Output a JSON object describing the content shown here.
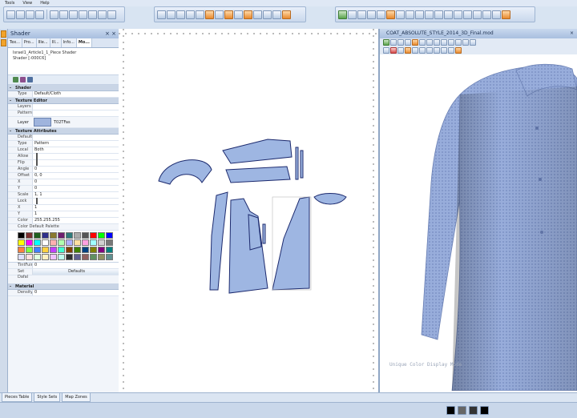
{
  "menu": [
    "Tools",
    "View",
    "Help"
  ],
  "shader_panel": {
    "title": "Shader",
    "close": "× ×",
    "tabs": [
      "Tex...",
      "Pro...",
      "Ille...",
      "Ill...",
      "Info...",
      "Mo..."
    ],
    "info_lines": [
      "Israel1_Article1_1_Piece Shader",
      "Shader [-000C6]"
    ],
    "sections": {
      "shader": "Shader",
      "type_label": "Type",
      "type_value": "Default/Cloth",
      "texture_editor": "Texture Editor",
      "layers": "Layers",
      "patterns": "Pattern",
      "layer_label": "Layer",
      "layer_value": "T02TFas",
      "texture_attributes": "Texture Attributes",
      "defaults": "Defaults",
      "attr_rows": [
        {
          "k": "Type",
          "v": "Pattern"
        },
        {
          "k": "Local",
          "v": "Both"
        },
        {
          "k": "Allow",
          "v": ""
        },
        {
          "k": "Flip",
          "v": ""
        },
        {
          "k": "Angle",
          "v": "0"
        },
        {
          "k": "Offset",
          "v": "0, 0"
        },
        {
          "k": "X",
          "v": "0"
        },
        {
          "k": "Y",
          "v": "0"
        },
        {
          "k": "Scale",
          "v": "1, 1"
        },
        {
          "k": "Lock",
          "v": ""
        },
        {
          "k": "X",
          "v": "1"
        },
        {
          "k": "Y",
          "v": "1"
        }
      ],
      "color_label": "Color",
      "color_value": "255.255.255",
      "color_palette_label": "Color Default Palette",
      "tint_label": "TintFuin",
      "tint_value": "0",
      "default_btn_label": "Set Dafal",
      "default_btn": "Defaults",
      "material": "Material",
      "density_label": "Density",
      "density_value": "0"
    }
  },
  "palette_colors": [
    "#000000",
    "#7a2f2f",
    "#1f5f1f",
    "#2f2f8a",
    "#8a7a2f",
    "#6e1f6e",
    "#2f7a7a",
    "#aaaaaa",
    "#555555",
    "#ff0000",
    "#00ff00",
    "#0000ff",
    "#ffff00",
    "#ff00ff",
    "#00ffff",
    "#ffffff",
    "#ffb0b0",
    "#b0ffb0",
    "#b0b0ff",
    "#ffe0a0",
    "#ffa0e0",
    "#a0ffff",
    "#d0d0d0",
    "#777777",
    "#ff8040",
    "#80ff40",
    "#4080ff",
    "#ffd040",
    "#c040ff",
    "#40ffd0",
    "#804000",
    "#408000",
    "#004080",
    "#808000",
    "#800080",
    "#008080",
    "#e0e0ff",
    "#ffe0e0",
    "#e0ffe0",
    "#fff0c0",
    "#f0c0ff",
    "#c0fff0",
    "#303030",
    "#606090",
    "#906060",
    "#609060",
    "#909060",
    "#609090"
  ],
  "view3d": {
    "title": "COAT_ABSOLUTE_STYLE_2014_3D_Final.mod",
    "status": "Unique Color Display Mode"
  },
  "bottom_tabs": [
    "Pieces Table",
    "Style Sets",
    "Map Zones"
  ],
  "colors": {
    "fabric": "#9eb6e2",
    "accent": "#e88a2e"
  }
}
